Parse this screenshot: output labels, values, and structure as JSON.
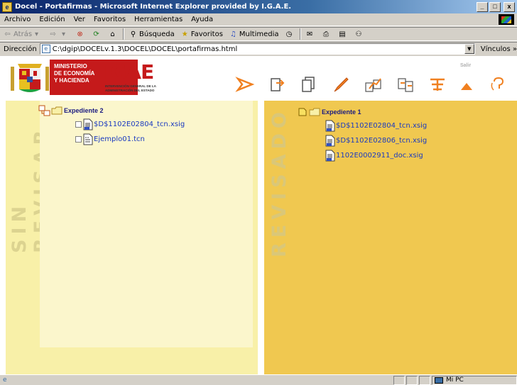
{
  "window": {
    "title": "Docel - Portafirmas - Microsoft Internet Explorer provided by I.G.A.E.",
    "minimize": "_",
    "maximize": "□",
    "close": "x"
  },
  "menu": [
    "Archivo",
    "Edición",
    "Ver",
    "Favoritos",
    "Herramientas",
    "Ayuda"
  ],
  "toolbar": {
    "back": "Atrás",
    "search": "Búsqueda",
    "favorites": "Favoritos",
    "multimedia": "Multimedia"
  },
  "address": {
    "label": "Dirección",
    "value": "C:\\dgip\\DOCELv.1.3\\DOCEL\\DOCEL\\portafirmas.html",
    "links": "Vínculos »"
  },
  "header": {
    "ministry_line1": "MINISTERIO",
    "ministry_line2": "DE ECONOMÍA",
    "ministry_line3": "Y HACIENDA",
    "igae": "IGAE",
    "igae_sub": "INTERVENCIÓN GENERAL DE LA ADMINISTRACIÓN DEL ESTADO",
    "salir": "Salir"
  },
  "left_panel": {
    "vertical_title": "SIN REVISAR",
    "expediente": "Expediente 2",
    "files": [
      "$D$1102E02804_tcn.xsig",
      "Ejemplo01.tcn"
    ]
  },
  "right_panel": {
    "vertical_title": "REVISADO",
    "expediente": "Expediente 1",
    "files": [
      "$D$1102E02804_tcn.xsig",
      "$D$1102E02806_tcn.xsig",
      "1102E0002911_doc.xsig"
    ]
  },
  "status": {
    "zone": "Mi PC"
  },
  "colors": {
    "left_panel_bg": "#f8f0a8",
    "right_panel_bg": "#f0c850",
    "link_blue": "#1a3ac0",
    "brand_red": "#c51a1b",
    "icon_orange": "#f08020"
  }
}
